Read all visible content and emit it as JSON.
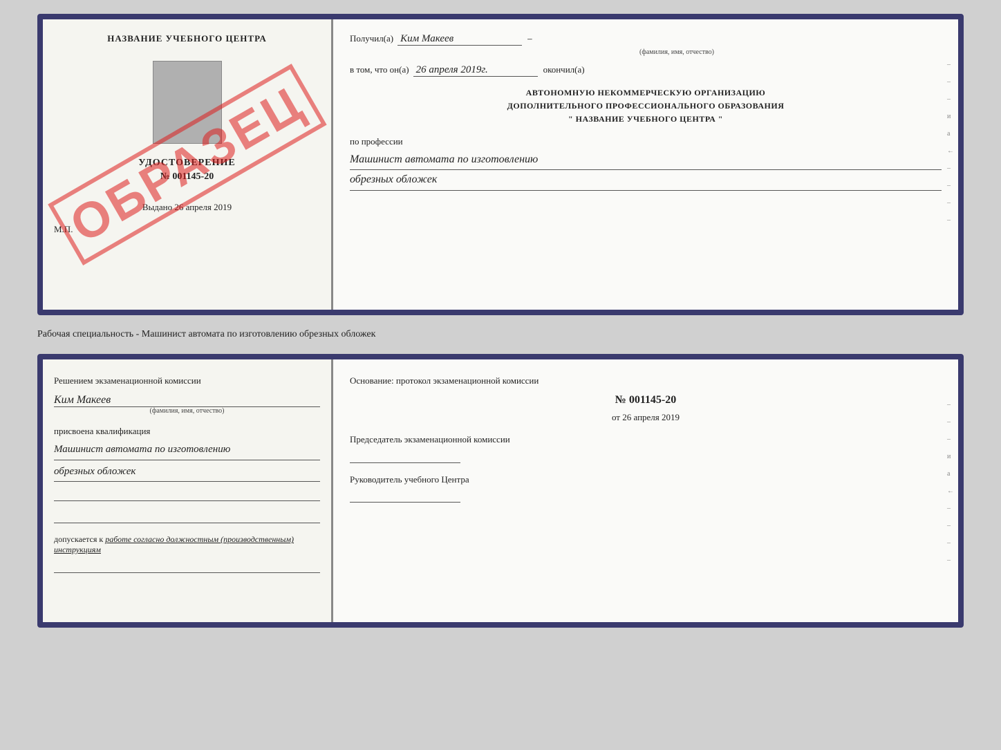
{
  "top_doc": {
    "left": {
      "title": "НАЗВАНИЕ УЧЕБНОГО ЦЕНТРА",
      "watermark": "ОБРАЗЕЦ",
      "udostoverenie": "УДОСТОВЕРЕНИЕ",
      "nomer": "№ 001145-20",
      "vydano_label": "Выдано",
      "vydano_date": "26 апреля 2019",
      "mp": "М.П."
    },
    "right": {
      "poluchil_label": "Получил(a)",
      "poluchil_name": "Ким Макеев",
      "fio_sub": "(фамилия, имя, отчество)",
      "vtom_label": "в том, что он(а)",
      "vtom_date": "26 апреля 2019г.",
      "okoncil_label": "окончил(а)",
      "org_line1": "АВТОНОМНУЮ НЕКОММЕРЧЕСКУЮ ОРГАНИЗАЦИЮ",
      "org_line2": "ДОПОЛНИТЕЛЬНОГО ПРОФЕССИОНАЛЬНОГО ОБРАЗОВАНИЯ",
      "org_name": "\"  НАЗВАНИЕ УЧЕБНОГО ЦЕНТРА  \"",
      "po_professii": "по профессии",
      "profession_line1": "Машинист автомата по изготовлению",
      "profession_line2": "обрезных обложек",
      "side_marks": [
        "-",
        "-",
        "-",
        "и",
        "а",
        "←",
        "-",
        "-",
        "-",
        "-"
      ]
    }
  },
  "specialty_text": "Рабочая специальность - Машинист автомата по изготовлению обрезных обложек",
  "bottom_doc": {
    "left": {
      "resheniem_label": "Решением экзаменационной комиссии",
      "name": "Ким Макеев",
      "fio_sub": "(фамилия, имя, отчество)",
      "prisvoena_label": "присвоена квалификация",
      "profession_line1": "Машинист автомата по изготовлению",
      "profession_line2": "обрезных обложек",
      "dopuskaetsya_label": "допускается к",
      "dopuskaetsya_value": "работе согласно должностным (производственным) инструкциям"
    },
    "right": {
      "osnovanie_label": "Основание: протокол экзаменационной комиссии",
      "nomer": "№  001145-20",
      "ot_label": "от",
      "ot_date": "26 апреля 2019",
      "predsedatel_label": "Председатель экзаменационной комиссии",
      "rukovoditel_label": "Руководитель учебного Центра",
      "side_marks": [
        "-",
        "-",
        "-",
        "и",
        "а",
        "←",
        "-",
        "-",
        "-",
        "-"
      ]
    }
  }
}
